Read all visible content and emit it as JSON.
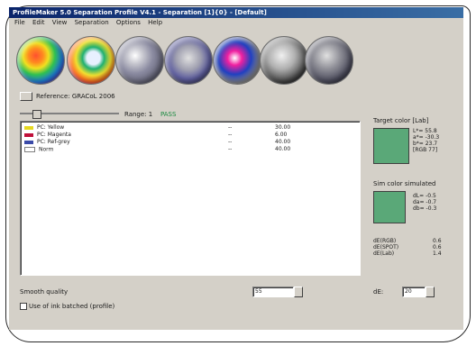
{
  "window": {
    "title": "ProfileMaker 5.0 Separation Profile V4.1 - Separation [1]{0} - [Default]",
    "menu": [
      "File",
      "Edit",
      "View",
      "Separation",
      "Options",
      "Help"
    ]
  },
  "toolbar": {
    "icons": [
      "monitor-profile-icon",
      "scanner-profile-icon",
      "camera-profile-icon",
      "printer-profile-icon",
      "separation-icon",
      "output-profile-icon",
      "printer-device-icon"
    ]
  },
  "source": {
    "label": "Reference: GRACoL 2006"
  },
  "ruler": {
    "range_label": "Range: 1",
    "status": "PASS"
  },
  "list": {
    "rows": [
      {
        "name": "PC: Yellow",
        "dash": "--",
        "value": "30.00",
        "color": "#e6d820"
      },
      {
        "name": "PC: Magenta",
        "dash": "--",
        "value": "6.00",
        "color": "#c0103a"
      },
      {
        "name": "PC: Ref-grey",
        "dash": "--",
        "value": "40.00",
        "color": "#3a4aa8"
      },
      {
        "name": "Norm",
        "dash": "--",
        "value": "40.00",
        "color": "#ffffff"
      }
    ]
  },
  "target": {
    "title": "Target color [Lab]",
    "values": [
      "L*= 55.8",
      "a*= -30.3",
      "b*= 23.7",
      "[RGB 77]"
    ]
  },
  "sim": {
    "title": "Sim color simulated",
    "values": [
      "dL= -0.5",
      "da= -0.7",
      "db= -0.3"
    ]
  },
  "delta": {
    "labels": [
      "dE(RGB)",
      "dE(SPOT)",
      "dE(Lab)"
    ],
    "values": [
      "0.6",
      "0.6",
      "1.4"
    ]
  },
  "colors": {
    "swatch": "#5aa878"
  },
  "bottom": {
    "left_label": "Smooth quality",
    "spin_value": "55",
    "dE_label": "dE:",
    "dE_value": "20",
    "checkbox_label": "Use of ink batched (profile)"
  }
}
